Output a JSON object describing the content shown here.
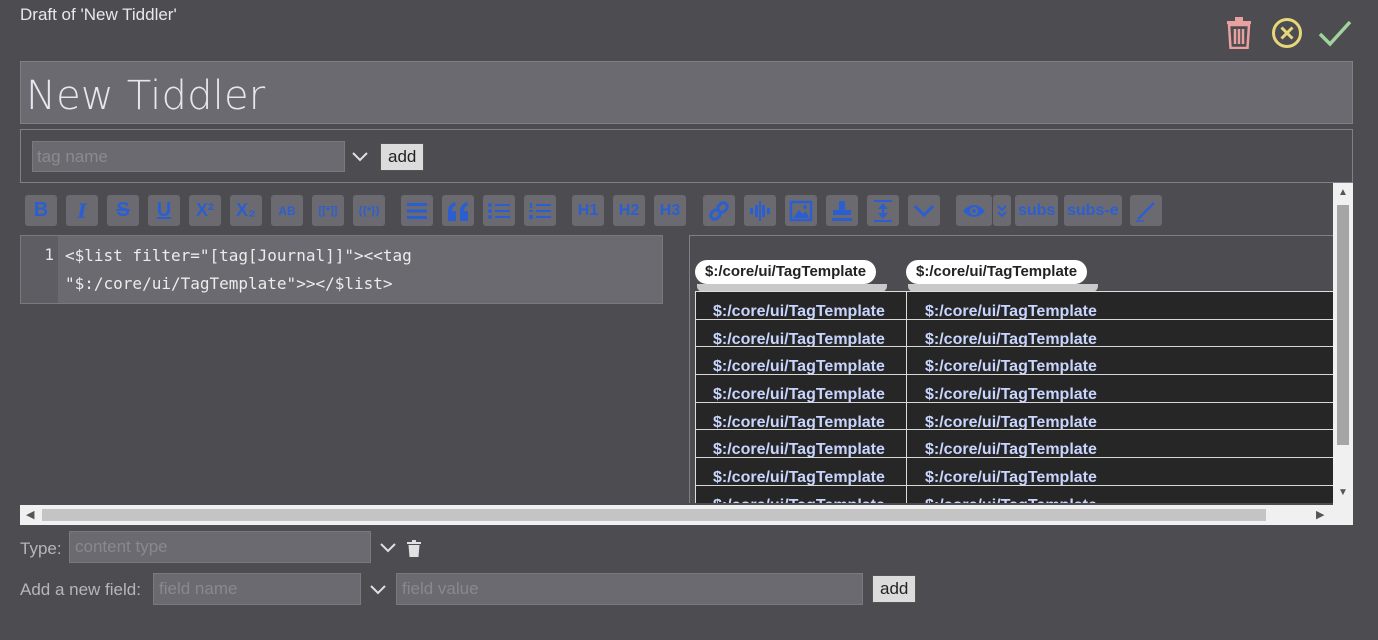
{
  "header": {
    "draft_label": "Draft of 'New Tiddler'"
  },
  "controls": {
    "delete": "delete-tiddler",
    "cancel": "cancel-edit",
    "done": "save-done"
  },
  "colors": {
    "delete": "#e8a0a0",
    "cancel": "#e8d77a",
    "done": "#9fd49b",
    "toolbar_icon": "#2b5fd1"
  },
  "title": {
    "value": "New Tiddler"
  },
  "tags": {
    "placeholder": "tag name",
    "add_label": "add"
  },
  "toolbar": {
    "subs": "subs",
    "subs_e": "subs-e",
    "h1": "H1",
    "h2": "H2",
    "h3": "H3",
    "bold": "B",
    "italic": "I",
    "strike": "S",
    "underline": "U",
    "superscript": "X²",
    "subscript": "X₂",
    "smallcaps": "AB",
    "transclude": "[[*]]",
    "variable": "{{*}}"
  },
  "editor": {
    "line_number": "1",
    "code": "<$list filter=\"[tag[Journal]]\"><<tag\n\"$:/core/ui/TagTemplate\">></$list>"
  },
  "preview": {
    "pills": [
      "$:/core/ui/TagTemplate",
      "$:/core/ui/TagTemplate"
    ],
    "col1": [
      "$:/core/ui/TagTemplate",
      "$:/core/ui/TagTemplate",
      "$:/core/ui/TagTemplate",
      "$:/core/ui/TagTemplate",
      "$:/core/ui/TagTemplate",
      "$:/core/ui/TagTemplate",
      "$:/core/ui/TagTemplate",
      "$:/core/ui/TagTemplate"
    ],
    "col2": [
      "$:/core/ui/TagTemplate",
      "$:/core/ui/TagTemplate",
      "$:/core/ui/TagTemplate",
      "$:/core/ui/TagTemplate",
      "$:/core/ui/TagTemplate",
      "$:/core/ui/TagTemplate",
      "$:/core/ui/TagTemplate",
      "$:/core/ui/TagTemplate"
    ]
  },
  "type": {
    "label": "Type:",
    "placeholder": "content type"
  },
  "fields": {
    "label": "Add a new field:",
    "name_placeholder": "field name",
    "value_placeholder": "field value",
    "add_label": "add"
  }
}
